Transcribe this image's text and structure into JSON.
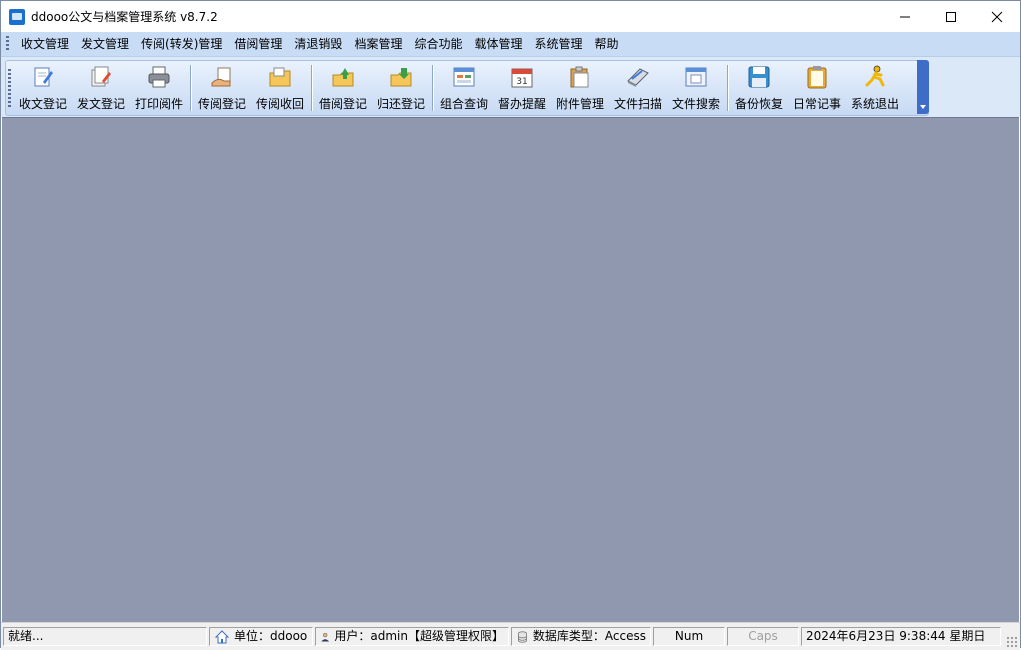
{
  "window": {
    "title": "ddooo公文与档案管理系统 v8.7.2"
  },
  "menu": [
    "收文管理",
    "发文管理",
    "传阅(转发)管理",
    "借阅管理",
    "清退销毁",
    "档案管理",
    "综合功能",
    "载体管理",
    "系统管理",
    "帮助"
  ],
  "toolbar": {
    "groups": [
      [
        {
          "label": "收文登记",
          "icon": "receive-register-icon"
        },
        {
          "label": "发文登记",
          "icon": "send-register-icon"
        },
        {
          "label": "打印阅件",
          "icon": "printer-icon"
        }
      ],
      [
        {
          "label": "传阅登记",
          "icon": "circulate-register-icon"
        },
        {
          "label": "传阅收回",
          "icon": "circulate-recall-icon"
        }
      ],
      [
        {
          "label": "借阅登记",
          "icon": "borrow-register-icon"
        },
        {
          "label": "归还登记",
          "icon": "return-register-icon"
        }
      ],
      [
        {
          "label": "组合查询",
          "icon": "combined-query-icon"
        },
        {
          "label": "督办提醒",
          "icon": "calendar-reminder-icon"
        },
        {
          "label": "附件管理",
          "icon": "attachment-icon"
        },
        {
          "label": "文件扫描",
          "icon": "scanner-icon"
        },
        {
          "label": "文件搜索",
          "icon": "file-search-icon"
        }
      ],
      [
        {
          "label": "备份恢复",
          "icon": "floppy-backup-icon"
        },
        {
          "label": "日常记事",
          "icon": "clipboard-notes-icon"
        },
        {
          "label": "系统退出",
          "icon": "running-man-exit-icon"
        }
      ]
    ]
  },
  "status": {
    "ready": "就绪...",
    "unit": "单位：ddooo",
    "user": "用户：admin【超级管理权限】",
    "db": "数据库类型：Access",
    "num": "Num",
    "caps": "Caps",
    "datetime": "2024年6月23日 9:38:44 星期日"
  },
  "colors": {
    "client_bg": "#8f98ae",
    "menubar_bg": "#c9dcf5",
    "toolbar_accent": "#3e6dc8"
  }
}
